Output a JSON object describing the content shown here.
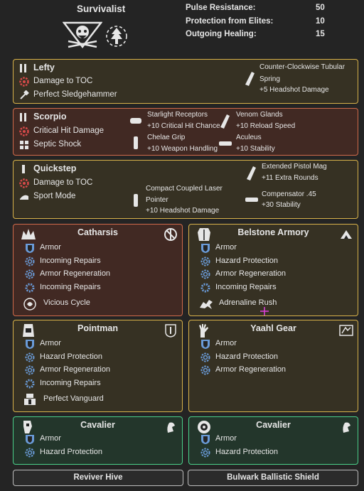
{
  "header": {
    "spec_name": "Survivalist",
    "stats": [
      {
        "label": "Pulse Resistance:",
        "value": "50"
      },
      {
        "label": "Protection from Elites:",
        "value": "10"
      },
      {
        "label": "Outgoing Healing:",
        "value": "15"
      }
    ]
  },
  "weapons": [
    {
      "name": "Lefty",
      "talents": [
        "Damage to TOC",
        "Perfect Sledgehammer"
      ],
      "mods": [
        {
          "name": "Counter-Clockwise Tubular",
          "name2": "Spring",
          "stat": "+5  Headshot Damage"
        }
      ]
    },
    {
      "name": "Scorpio",
      "talents": [
        "Critical Hit Damage",
        "Septic Shock"
      ],
      "mods": [
        {
          "name": "Starlight Receptors",
          "stat": "+10  Critical Hit Chance"
        },
        {
          "name": "Chelae Grip",
          "stat": "+10  Weapon Handling"
        },
        {
          "name": "Venom Glands",
          "stat": "+10  Reload Speed"
        },
        {
          "name": "Aculeus",
          "stat": "+10  Stability"
        }
      ]
    },
    {
      "name": "Quickstep",
      "talents": [
        "Damage to TOC",
        "Sport Mode"
      ],
      "mods": [
        {
          "name": "Compact Coupled Laser",
          "name2": "Pointer",
          "stat": "+10  Headshot Damage"
        },
        {
          "name": "Extended Pistol Mag",
          "stat": "+11  Extra Rounds"
        },
        {
          "name": "Compensator .45",
          "stat": "+30  Stability"
        }
      ]
    }
  ],
  "gear": [
    {
      "title": "Catharsis",
      "lines": [
        "Armor",
        "Incoming Repairs",
        "Armor Regeneration",
        "Incoming Repairs"
      ],
      "talent": "Vicious Cycle"
    },
    {
      "title": "Belstone Armory",
      "lines": [
        "Armor",
        "Hazard Protection",
        "Armor Regeneration",
        "Incoming Repairs"
      ],
      "talent": "Adrenaline Rush"
    },
    {
      "title": "Pointman",
      "lines": [
        "Armor",
        "Hazard Protection",
        "Armor Regeneration",
        "Incoming Repairs"
      ],
      "talent": "Perfect Vanguard"
    },
    {
      "title": "Yaahl Gear",
      "lines": [
        "Armor",
        "Hazard Protection",
        "Armor Regeneration"
      ],
      "talent": ""
    },
    {
      "title": "Cavalier",
      "lines": [
        "Armor",
        "Hazard Protection"
      ],
      "talent": ""
    },
    {
      "title": "Cavalier",
      "lines": [
        "Armor",
        "Hazard Protection"
      ],
      "talent": ""
    }
  ],
  "buttons": {
    "skill1": "Reviver Hive",
    "skill2": "Bulwark Ballistic Shield"
  },
  "colors": {
    "gold_border": "#d8b24a",
    "red_border": "#d06a4a",
    "green_border": "#4ad08a",
    "armor_blue": "#6a9bd8",
    "damage_red": "#d84a4a"
  }
}
